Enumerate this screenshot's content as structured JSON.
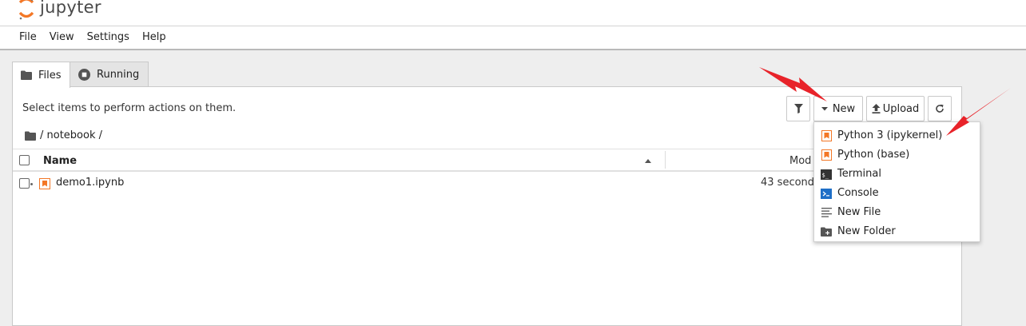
{
  "app": {
    "logo_text": "jupyter"
  },
  "menubar": {
    "items": [
      "File",
      "View",
      "Settings",
      "Help"
    ]
  },
  "tabs": {
    "files": "Files",
    "running": "Running"
  },
  "toolbar": {
    "hint": "Select items to perform actions on them.",
    "new_label": "New",
    "upload_label": "Upload"
  },
  "breadcrumb": {
    "path": "/ notebook /"
  },
  "table": {
    "col_name": "Name",
    "col_modified": "Mod",
    "rows": [
      {
        "name": "demo1.ipynb",
        "modified": "43 seconds"
      }
    ]
  },
  "new_menu": {
    "items": [
      {
        "label": "Python 3 (ipykernel)",
        "icon": "notebook-icon"
      },
      {
        "label": "Python (base)",
        "icon": "notebook-icon"
      },
      {
        "label": "Terminal",
        "icon": "terminal-icon"
      },
      {
        "label": "Console",
        "icon": "console-icon"
      },
      {
        "label": "New File",
        "icon": "text-file-icon"
      },
      {
        "label": "New Folder",
        "icon": "new-folder-icon"
      }
    ]
  },
  "colors": {
    "notebook_orange": "#f37726",
    "annotation_red": "#e8232a",
    "console_blue": "#1f6fc7"
  }
}
